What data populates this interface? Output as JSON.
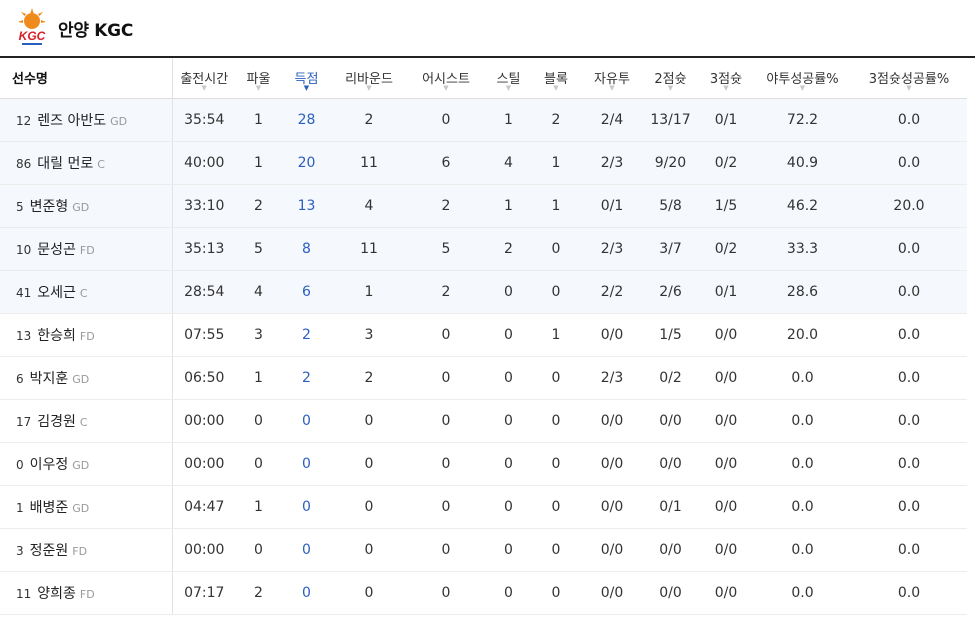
{
  "team": {
    "name": "안양 KGC",
    "logo_text": "KGC",
    "logo_icon": "kgc-sunburst-logo"
  },
  "columns": [
    {
      "key": "player",
      "label": "선수명"
    },
    {
      "key": "min",
      "label": "출전시간"
    },
    {
      "key": "pf",
      "label": "파울"
    },
    {
      "key": "pts",
      "label": "득점",
      "sorted": true
    },
    {
      "key": "reb",
      "label": "리바운드"
    },
    {
      "key": "ast",
      "label": "어시스트"
    },
    {
      "key": "stl",
      "label": "스틸"
    },
    {
      "key": "blk",
      "label": "블록"
    },
    {
      "key": "ft",
      "label": "자유투"
    },
    {
      "key": "fg2",
      "label": "2점슛"
    },
    {
      "key": "fg3",
      "label": "3점슛"
    },
    {
      "key": "fgpct",
      "label": "야투성공률%"
    },
    {
      "key": "fg3pct",
      "label": "3점슛성공률%"
    }
  ],
  "players": [
    {
      "num": "12",
      "name": "렌즈 아반도",
      "pos": "GD",
      "min": "35:54",
      "pf": "1",
      "pts": "28",
      "reb": "2",
      "ast": "0",
      "stl": "1",
      "blk": "2",
      "ft": "2/4",
      "fg2": "13/17",
      "fg3": "0/1",
      "fgpct": "72.2",
      "fg3pct": "0.0",
      "starter": true
    },
    {
      "num": "86",
      "name": "대릴 먼로",
      "pos": "C",
      "min": "40:00",
      "pf": "1",
      "pts": "20",
      "reb": "11",
      "ast": "6",
      "stl": "4",
      "blk": "1",
      "ft": "2/3",
      "fg2": "9/20",
      "fg3": "0/2",
      "fgpct": "40.9",
      "fg3pct": "0.0",
      "starter": true
    },
    {
      "num": "5",
      "name": "변준형",
      "pos": "GD",
      "min": "33:10",
      "pf": "2",
      "pts": "13",
      "reb": "4",
      "ast": "2",
      "stl": "1",
      "blk": "1",
      "ft": "0/1",
      "fg2": "5/8",
      "fg3": "1/5",
      "fgpct": "46.2",
      "fg3pct": "20.0",
      "starter": true
    },
    {
      "num": "10",
      "name": "문성곤",
      "pos": "FD",
      "min": "35:13",
      "pf": "5",
      "pts": "8",
      "reb": "11",
      "ast": "5",
      "stl": "2",
      "blk": "0",
      "ft": "2/3",
      "fg2": "3/7",
      "fg3": "0/2",
      "fgpct": "33.3",
      "fg3pct": "0.0",
      "starter": true
    },
    {
      "num": "41",
      "name": "오세근",
      "pos": "C",
      "min": "28:54",
      "pf": "4",
      "pts": "6",
      "reb": "1",
      "ast": "2",
      "stl": "0",
      "blk": "0",
      "ft": "2/2",
      "fg2": "2/6",
      "fg3": "0/1",
      "fgpct": "28.6",
      "fg3pct": "0.0",
      "starter": true
    },
    {
      "num": "13",
      "name": "한승희",
      "pos": "FD",
      "min": "07:55",
      "pf": "3",
      "pts": "2",
      "reb": "3",
      "ast": "0",
      "stl": "0",
      "blk": "1",
      "ft": "0/0",
      "fg2": "1/5",
      "fg3": "0/0",
      "fgpct": "20.0",
      "fg3pct": "0.0",
      "starter": false
    },
    {
      "num": "6",
      "name": "박지훈",
      "pos": "GD",
      "min": "06:50",
      "pf": "1",
      "pts": "2",
      "reb": "2",
      "ast": "0",
      "stl": "0",
      "blk": "0",
      "ft": "2/3",
      "fg2": "0/2",
      "fg3": "0/0",
      "fgpct": "0.0",
      "fg3pct": "0.0",
      "starter": false
    },
    {
      "num": "17",
      "name": "김경원",
      "pos": "C",
      "min": "00:00",
      "pf": "0",
      "pts": "0",
      "reb": "0",
      "ast": "0",
      "stl": "0",
      "blk": "0",
      "ft": "0/0",
      "fg2": "0/0",
      "fg3": "0/0",
      "fgpct": "0.0",
      "fg3pct": "0.0",
      "starter": false
    },
    {
      "num": "0",
      "name": "이우정",
      "pos": "GD",
      "min": "00:00",
      "pf": "0",
      "pts": "0",
      "reb": "0",
      "ast": "0",
      "stl": "0",
      "blk": "0",
      "ft": "0/0",
      "fg2": "0/0",
      "fg3": "0/0",
      "fgpct": "0.0",
      "fg3pct": "0.0",
      "starter": false
    },
    {
      "num": "1",
      "name": "배병준",
      "pos": "GD",
      "min": "04:47",
      "pf": "1",
      "pts": "0",
      "reb": "0",
      "ast": "0",
      "stl": "0",
      "blk": "0",
      "ft": "0/0",
      "fg2": "0/1",
      "fg3": "0/0",
      "fgpct": "0.0",
      "fg3pct": "0.0",
      "starter": false
    },
    {
      "num": "3",
      "name": "정준원",
      "pos": "FD",
      "min": "00:00",
      "pf": "0",
      "pts": "0",
      "reb": "0",
      "ast": "0",
      "stl": "0",
      "blk": "0",
      "ft": "0/0",
      "fg2": "0/0",
      "fg3": "0/0",
      "fgpct": "0.0",
      "fg3pct": "0.0",
      "starter": false
    },
    {
      "num": "11",
      "name": "양희종",
      "pos": "FD",
      "min": "07:17",
      "pf": "2",
      "pts": "0",
      "reb": "0",
      "ast": "0",
      "stl": "0",
      "blk": "0",
      "ft": "0/0",
      "fg2": "0/0",
      "fg3": "0/0",
      "fgpct": "0.0",
      "fg3pct": "0.0",
      "starter": false
    }
  ],
  "colors": {
    "accent": "#2b5fbd",
    "starter_row_bg": "#f5f8fd",
    "logo_orange": "#f08a1c",
    "logo_red": "#d8202a"
  }
}
